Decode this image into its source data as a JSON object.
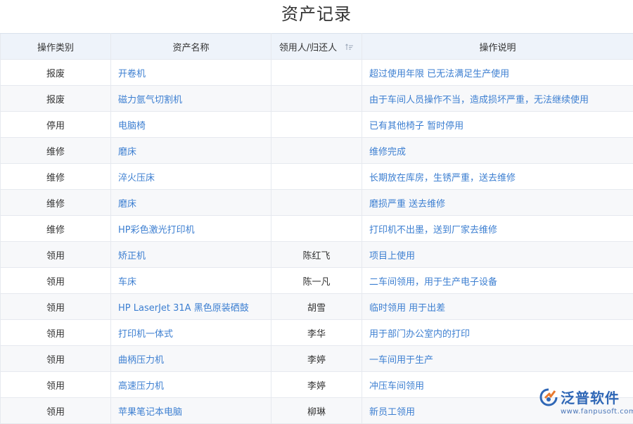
{
  "page": {
    "title": "资产记录"
  },
  "table": {
    "headers": {
      "category": "操作类别",
      "asset_name": "资产名称",
      "person": "领用人/归还人",
      "description": "操作说明"
    },
    "sort_icon": "sort-ascending-icon",
    "rows": [
      {
        "category": "报废",
        "asset_name": "开卷机",
        "person": "",
        "description": "超过使用年限 已无法满足生产使用"
      },
      {
        "category": "报废",
        "asset_name": "磁力氩气切割机",
        "person": "",
        "description": "由于车间人员操作不当，造成损坏严重，无法继续使用"
      },
      {
        "category": "停用",
        "asset_name": "电脑椅",
        "person": "",
        "description": "已有其他椅子 暂时停用"
      },
      {
        "category": "维修",
        "asset_name": "磨床",
        "person": "",
        "description": "维修完成"
      },
      {
        "category": "维修",
        "asset_name": "淬火压床",
        "person": "",
        "description": "长期放在库房，生锈严重，送去维修"
      },
      {
        "category": "维修",
        "asset_name": "磨床",
        "person": "",
        "description": "磨损严重 送去维修"
      },
      {
        "category": "维修",
        "asset_name": "HP彩色激光打印机",
        "person": "",
        "description": "打印机不出墨，送到厂家去维修"
      },
      {
        "category": "领用",
        "asset_name": "矫正机",
        "person": "陈红飞",
        "description": "项目上使用"
      },
      {
        "category": "领用",
        "asset_name": "车床",
        "person": "陈一凡",
        "description": "二车间领用，用于生产电子设备"
      },
      {
        "category": "领用",
        "asset_name": "HP LaserJet 31A 黑色原装硒鼓",
        "person": "胡雪",
        "description": "临时领用 用于出差"
      },
      {
        "category": "领用",
        "asset_name": "打印机一体式",
        "person": "李华",
        "description": "用于部门办公室内的打印"
      },
      {
        "category": "领用",
        "asset_name": "曲柄压力机",
        "person": "李婷",
        "description": "一车间用于生产"
      },
      {
        "category": "领用",
        "asset_name": "高速压力机",
        "person": "李婷",
        "description": "冲压车间领用"
      },
      {
        "category": "领用",
        "asset_name": "苹果笔记本电脑",
        "person": "柳琳",
        "description": "新员工领用"
      }
    ]
  },
  "logo": {
    "name": "泛普软件",
    "url": "www.fanpusoft.com",
    "icon": "fanpu-logo-icon",
    "colors": {
      "primary": "#2f67b6",
      "accent": "#e8792e"
    }
  },
  "colors": {
    "link": "#3d7fd1",
    "header_bg": "#eef3fa",
    "row_alt_bg": "#f7f8fa",
    "border": "#e6e9ef"
  }
}
